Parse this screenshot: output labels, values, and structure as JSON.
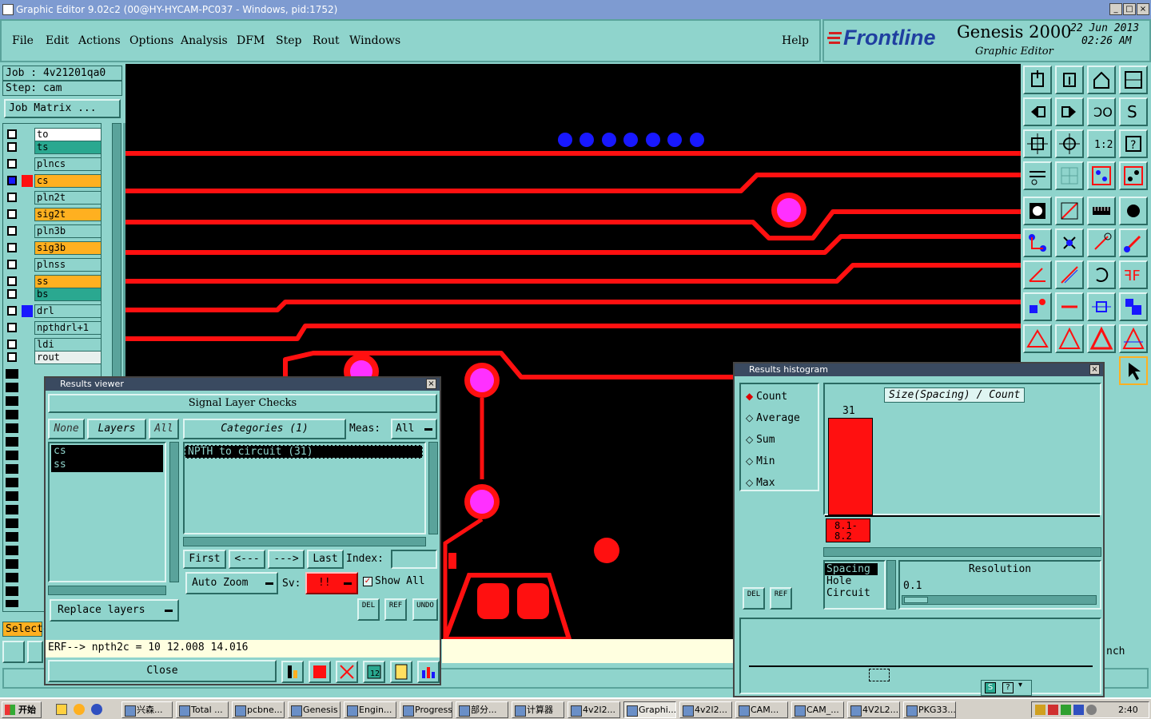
{
  "window": {
    "title": "Graphic Editor 9.02c2 (00@HY-HYCAM-PC037 - Windows, pid:1752)",
    "min": "_",
    "max": "□",
    "close": "×"
  },
  "menu": [
    "File",
    "Edit",
    "Actions",
    "Options",
    "Analysis",
    "DFM",
    "Step",
    "Rout",
    "Windows"
  ],
  "help": "Help",
  "brand": {
    "logo": "Frontline",
    "product": "Genesis 2000",
    "subtitle": "Graphic Editor",
    "date": "22  Jun 2013",
    "time": "02:26 AM"
  },
  "job": {
    "job_label": "Job : 4v21201qa0",
    "step_label": "Step: cam",
    "matrix_button": "Job Matrix ..."
  },
  "layers": [
    {
      "name": "to",
      "color": "#ffffff"
    },
    {
      "name": "ts",
      "color": "#2aa890"
    },
    {
      "name": "plncs",
      "color": "#8fd4cc"
    },
    {
      "name": "cs",
      "color": "#ffb020"
    },
    {
      "name": "pln2t",
      "color": "#8fd4cc"
    },
    {
      "name": "sig2t",
      "color": "#ffb020"
    },
    {
      "name": "pln3b",
      "color": "#8fd4cc"
    },
    {
      "name": "sig3b",
      "color": "#ffb020"
    },
    {
      "name": "plnss",
      "color": "#8fd4cc"
    },
    {
      "name": "ss",
      "color": "#ffb020"
    },
    {
      "name": "bs",
      "color": "#2aa890"
    },
    {
      "name": "drl",
      "color": "#8fd4cc"
    },
    {
      "name": "npthdrl+1",
      "color": "#8fd4cc"
    },
    {
      "name": "ldi",
      "color": "#8fd4cc"
    },
    {
      "name": "rout",
      "color": "#e8f0ee"
    }
  ],
  "results_viewer": {
    "title": "Results viewer",
    "header": "Signal Layer Checks",
    "none": "None",
    "layers": "Layers",
    "all": "All",
    "categories": "Categories (1)",
    "meas_label": "Meas:",
    "meas_value": "All",
    "layer_items": [
      "cs",
      "ss"
    ],
    "category_items": [
      "NPTH to circuit (31)"
    ],
    "first": "First",
    "prev": "<---",
    "next": "--->",
    "last": "Last",
    "index_label": "Index:",
    "auto_zoom": "Auto Zoom",
    "sv_label": "Sv:",
    "sv_value": "!!",
    "show_all": "Show All",
    "replace_layers": "Replace layers",
    "del": "DEL",
    "ref": "REF",
    "undo": "UNDO",
    "erf_line": "ERF--> npth2c = 10 12.008 14.016",
    "close": "Close"
  },
  "histogram": {
    "title": "Results histogram",
    "stats": [
      "Count",
      "Average",
      "Sum",
      "Min",
      "Max"
    ],
    "selected_stat": "Count",
    "chart_title": "Size(Spacing) / Count",
    "bar_count": "31",
    "bar_label": "8.1-\n8.2",
    "types": [
      "Spacing",
      "Hole",
      "Circuit"
    ],
    "resolution_label": "Resolution",
    "resolution_value": "0.1",
    "del": "DEL",
    "ref": "REF"
  },
  "status": {
    "selected": "Selecte",
    "right_text": "nch"
  },
  "taskbar": {
    "start": "开始",
    "tasks": [
      "兴森...",
      "Total ...",
      "pcbne...",
      "Genesis",
      "Engin...",
      "Progress",
      "部分...",
      "计算器",
      "4v2l2...",
      "Graphi...",
      "4v2l2...",
      "CAM...",
      "CAM_...",
      "4V2L2...",
      "PKG33..."
    ],
    "clock": "2:40"
  },
  "colors": {
    "panel": "#8fd4cc",
    "trace": "#ff1010",
    "pad": "#ff30ff",
    "drill": "#1818ff"
  }
}
